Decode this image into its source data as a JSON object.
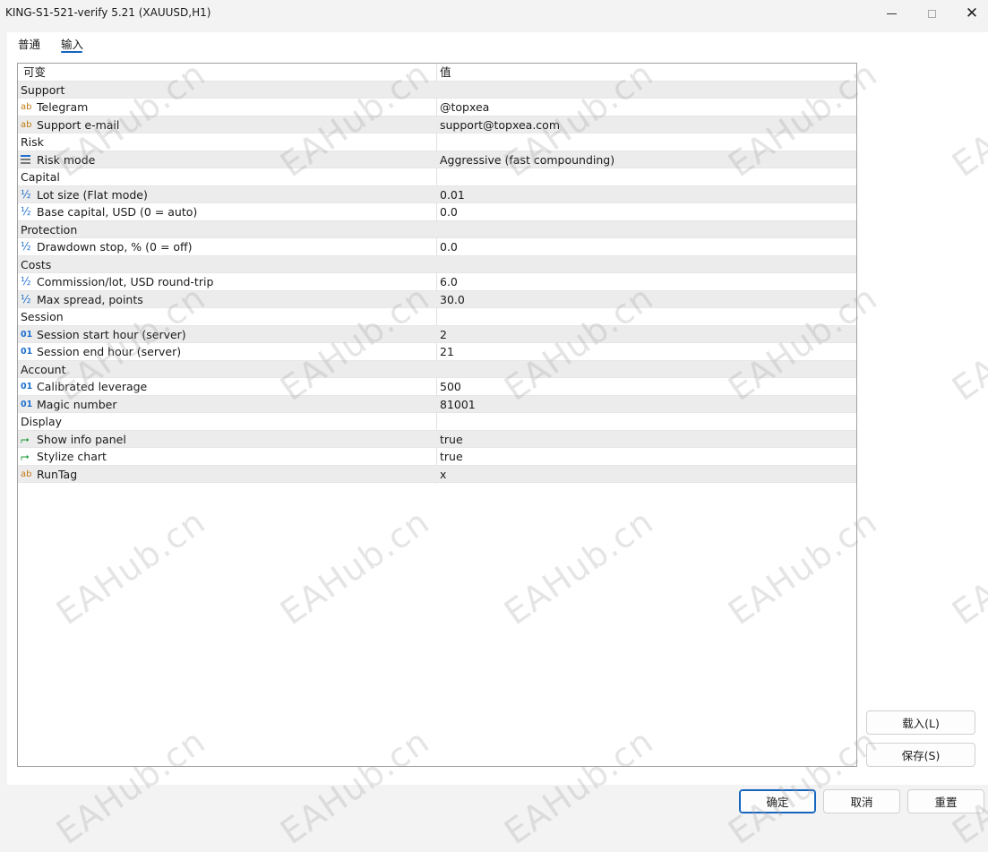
{
  "window": {
    "title": "KING-S1-521-verify 5.21 (XAUUSD,H1)"
  },
  "tabs": [
    {
      "label": "普通"
    },
    {
      "label": "输入"
    }
  ],
  "table": {
    "headers": {
      "variable": "可变",
      "value": "值"
    },
    "rows": [
      {
        "kind": "group",
        "name": "Support",
        "value": ""
      },
      {
        "kind": "param",
        "icon": "string-icon",
        "name": "Telegram",
        "value": "@topxea"
      },
      {
        "kind": "param",
        "icon": "string-icon",
        "name": "Support e-mail",
        "value": "support@topxea.com"
      },
      {
        "kind": "group",
        "name": "Risk",
        "value": ""
      },
      {
        "kind": "param",
        "icon": "enum-icon",
        "name": "Risk mode",
        "value": "Aggressive (fast compounding)"
      },
      {
        "kind": "group",
        "name": "Capital",
        "value": ""
      },
      {
        "kind": "param",
        "icon": "double-icon",
        "name": "Lot size (Flat mode)",
        "value": "0.01"
      },
      {
        "kind": "param",
        "icon": "double-icon",
        "name": "Base capital, USD (0 = auto)",
        "value": "0.0"
      },
      {
        "kind": "group",
        "name": "Protection",
        "value": ""
      },
      {
        "kind": "param",
        "icon": "double-icon",
        "name": "Drawdown stop, % (0 = off)",
        "value": "0.0"
      },
      {
        "kind": "group",
        "name": "Costs",
        "value": ""
      },
      {
        "kind": "param",
        "icon": "double-icon",
        "name": "Commission/lot, USD round-trip",
        "value": "6.0"
      },
      {
        "kind": "param",
        "icon": "double-icon",
        "name": "Max spread, points",
        "value": "30.0"
      },
      {
        "kind": "group",
        "name": "Session",
        "value": ""
      },
      {
        "kind": "param",
        "icon": "integer-icon",
        "name": "Session start hour (server)",
        "value": "2"
      },
      {
        "kind": "param",
        "icon": "integer-icon",
        "name": "Session end hour (server)",
        "value": "21"
      },
      {
        "kind": "group",
        "name": "Account",
        "value": ""
      },
      {
        "kind": "param",
        "icon": "integer-icon",
        "name": "Calibrated leverage",
        "value": "500"
      },
      {
        "kind": "param",
        "icon": "integer-icon",
        "name": "Magic number",
        "value": "81001"
      },
      {
        "kind": "group",
        "name": "Display",
        "value": ""
      },
      {
        "kind": "param",
        "icon": "bool-icon",
        "name": "Show info panel",
        "value": "true"
      },
      {
        "kind": "param",
        "icon": "bool-icon",
        "name": "Stylize chart",
        "value": "true"
      },
      {
        "kind": "param",
        "icon": "string-icon",
        "name": "RunTag",
        "value": "x"
      }
    ]
  },
  "buttons": {
    "load": "载入(L)",
    "save": "保存(S)",
    "ok": "确定",
    "cancel": "取消",
    "reset": "重置"
  },
  "icon_glyphs": {
    "string-icon": "ab",
    "integer-icon": "01",
    "double-icon": "½",
    "bool-icon": "⮣"
  },
  "watermark": "EAHub.cn",
  "colors": {
    "accent": "#1565c0",
    "row_alt": "#ececec",
    "string_icon": "#c17b12",
    "number_icon": "#1e6fd0",
    "bool_icon": "#1a9a3a"
  }
}
